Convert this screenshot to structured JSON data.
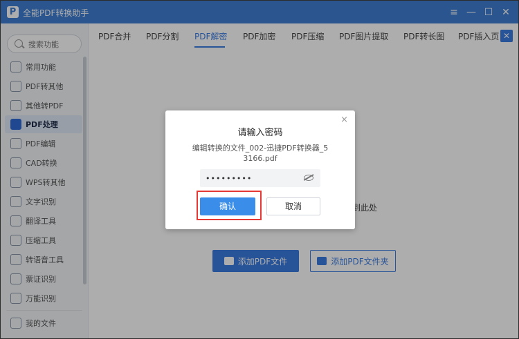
{
  "app": {
    "title": "全能PDF转换助手",
    "logo_letter": "P",
    "window_controls": {
      "menu": "≡",
      "minimize": "—",
      "maximize": "☐",
      "close": "✕"
    }
  },
  "search": {
    "placeholder": "搜索功能"
  },
  "sidebar": {
    "items": [
      {
        "label": "常用功能"
      },
      {
        "label": "PDF转其他"
      },
      {
        "label": "其他转PDF"
      },
      {
        "label": "PDF处理",
        "active": true
      },
      {
        "label": "PDF编辑"
      },
      {
        "label": "CAD转换"
      },
      {
        "label": "WPS转其他"
      },
      {
        "label": "文字识别"
      },
      {
        "label": "翻译工具"
      },
      {
        "label": "压缩工具"
      },
      {
        "label": "转语音工具"
      },
      {
        "label": "票证识别"
      },
      {
        "label": "万能识别"
      }
    ],
    "footer_item": {
      "label": "我的文件"
    }
  },
  "tabs": {
    "items": [
      {
        "label": "PDF合并"
      },
      {
        "label": "PDF分割"
      },
      {
        "label": "PDF解密",
        "active": true
      },
      {
        "label": "PDF加密"
      },
      {
        "label": "PDF压缩"
      },
      {
        "label": "PDF图片提取"
      },
      {
        "label": "PDF转长图"
      },
      {
        "label": "PDF插入页"
      }
    ],
    "close_glyph": "✕"
  },
  "content": {
    "drop_hint": "到此处",
    "add_file_button": "添加PDF文件",
    "add_folder_button": "添加PDF文件夹"
  },
  "dialog": {
    "title": "请输入密码",
    "file_name": "编辑转换的文件_002-迅捷PDF转换器_53166.pdf",
    "password_value": "•••••••••",
    "confirm_label": "确认",
    "cancel_label": "取消",
    "close_glyph": "×"
  },
  "colors": {
    "titlebar": "#3f7ed2",
    "accent": "#3a7be0",
    "highlight": "#e53935"
  }
}
